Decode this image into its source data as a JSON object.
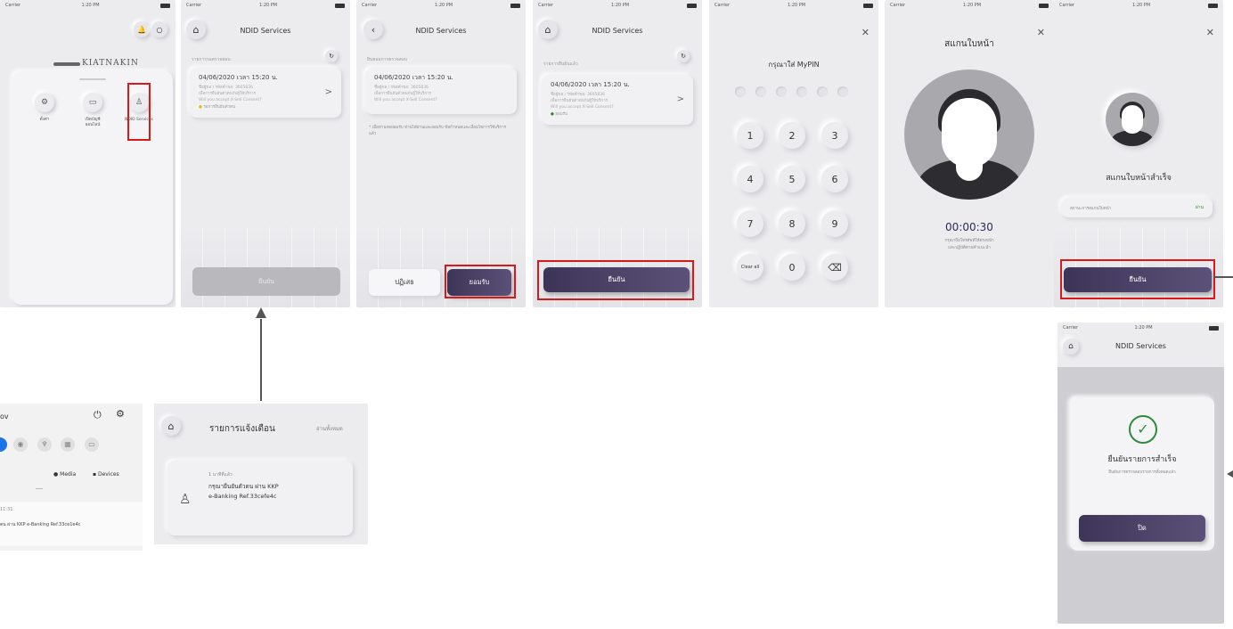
{
  "status_bar": {
    "carrier": "Carrier",
    "time": "1:20 PM",
    "battery": "100%"
  },
  "screen1": {
    "brand": "KIATNAKIN",
    "menu": [
      "ตั้งค่า",
      "เปิดบัญชี ออนไลน์",
      "NDID Services"
    ]
  },
  "ndid_title": "NDID Services",
  "request": {
    "section_pending": "รายการรอตรวจสอบ",
    "section_consent": "ยินยอมการตรวจสอบ",
    "section_done": "รายการยืนยันแล้ว",
    "date": "04/06/2020 เวลา 15:20 น.",
    "line1": "ชื่อผู้ขอ / รหัสคำขอ: 3605836",
    "line2": "เพื่อการยืนยันตัวตนกับผู้ให้บริการ",
    "line3": "Will you accept X-Sell Consent?",
    "status_waiting": "รอการยืนยันตัวตน",
    "status_ok": "ยอมรับ",
    "chevron": ">"
  },
  "consent_note": "* เมื่อท่านกดยอมรับ ท่านได้อ่านและยอมรับ ข้อกำหนดและเงื่อนไขการใช้บริการ แล้ว",
  "buttons": {
    "confirm": "ยืนยัน",
    "reject": "ปฏิเสธ",
    "accept": "ยอมรับ",
    "close": "ปิด"
  },
  "pin": {
    "title": "กรุณาใส่ MyPIN",
    "keys": [
      "1",
      "2",
      "3",
      "4",
      "5",
      "6",
      "7",
      "8",
      "9",
      "Clear all",
      "0",
      "⌫"
    ]
  },
  "scan": {
    "title": "สแกนใบหน้า",
    "timer": "00:00:30",
    "hint1": "กรุณาถือโทรศัพท์ให้ตรงหน้า",
    "hint2": "และปฏิบัติตามคำแนะนำ"
  },
  "scan_done": {
    "title": "สแกนใบหน้าสำเร็จ",
    "row_label": "สถานะการสแกนใบหน้า",
    "row_value": "ผ่าน"
  },
  "notification": {
    "title": "รายการแจ้งเตือน",
    "read_all": "อ่านทั้งหมด",
    "sub": "1 นาทีที่แล้ว",
    "msg1": "กรุณายืนยันตัวตน ผ่าน KKP",
    "msg2": "e-Banking Ref.33cefe4c"
  },
  "android": {
    "header": "ov",
    "media": "Media",
    "devices": "Devices",
    "time": "11:31",
    "msg": "ตน ผ่าน KKP e-Banking Ref.33ce1e4c"
  },
  "success": {
    "title": "ยืนยันรายการสำเร็จ",
    "sub": "ยืนยันการตรวจสอบรายการทั้งหมดแล้ว"
  },
  "colors": {
    "accent": "#3d3558",
    "highlight": "#d7191c",
    "background": "#ececef"
  }
}
